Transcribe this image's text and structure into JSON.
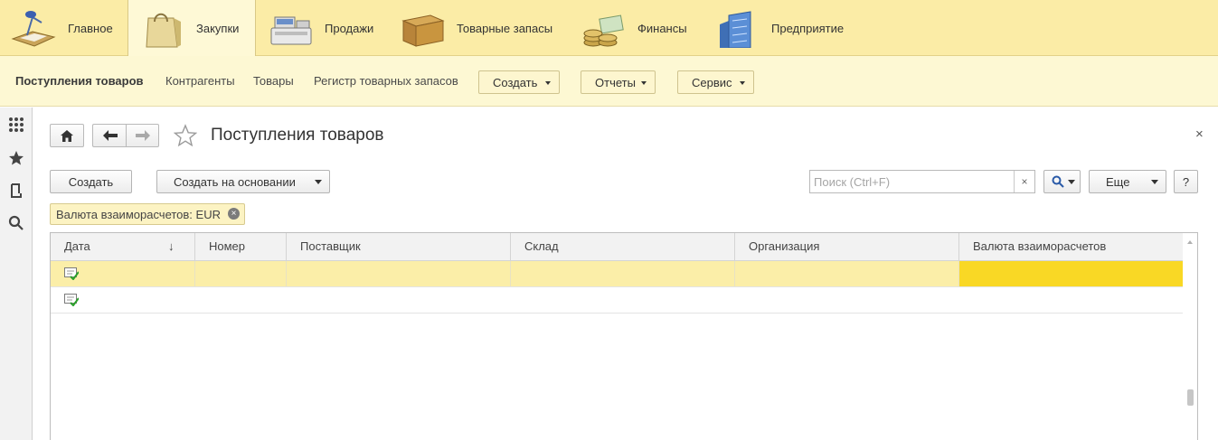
{
  "sections": [
    {
      "label": "Главное",
      "icon": "desk-lamp-icon",
      "active": false
    },
    {
      "label": "Закупки",
      "icon": "shopping-bag-icon",
      "active": true
    },
    {
      "label": "Продажи",
      "icon": "cash-register-icon",
      "active": false
    },
    {
      "label": "Товарные запасы",
      "icon": "cardboard-box-icon",
      "active": false
    },
    {
      "label": "Финансы",
      "icon": "coins-icon",
      "active": false
    },
    {
      "label": "Предприятие",
      "icon": "office-building-icon",
      "active": false
    }
  ],
  "subnav": {
    "links": [
      "Поступления товаров",
      "Контрагенты",
      "Товары",
      "Регистр товарных запасов"
    ],
    "dropdowns": [
      "Создать",
      "Отчеты",
      "Сервис"
    ]
  },
  "form": {
    "title": "Поступления товаров",
    "create_label": "Создать",
    "create_based_label": "Создать на основании",
    "search_placeholder": "Поиск (Ctrl+F)",
    "search_clear": "×",
    "more_label": "Еще",
    "help_label": "?",
    "close_label": "×",
    "filter_text": "Валюта взаиморасчетов: EUR"
  },
  "table": {
    "columns": [
      "Дата",
      "Номер",
      "Поставщик",
      "Склад",
      "Организация",
      "Валюта взаиморасчетов"
    ],
    "sort_indicator": "↓",
    "rows": [
      {
        "date": "",
        "number": "",
        "supplier": "",
        "warehouse": "",
        "organization": "",
        "currency": "",
        "selected": true
      },
      {
        "date": "",
        "number": "",
        "supplier": "",
        "warehouse": "",
        "organization": "",
        "currency": "",
        "selected": false
      }
    ]
  },
  "colors": {
    "section_bar": "#fbeca6",
    "selected_row": "#fbeea8",
    "current_cell": "#f9d825"
  }
}
